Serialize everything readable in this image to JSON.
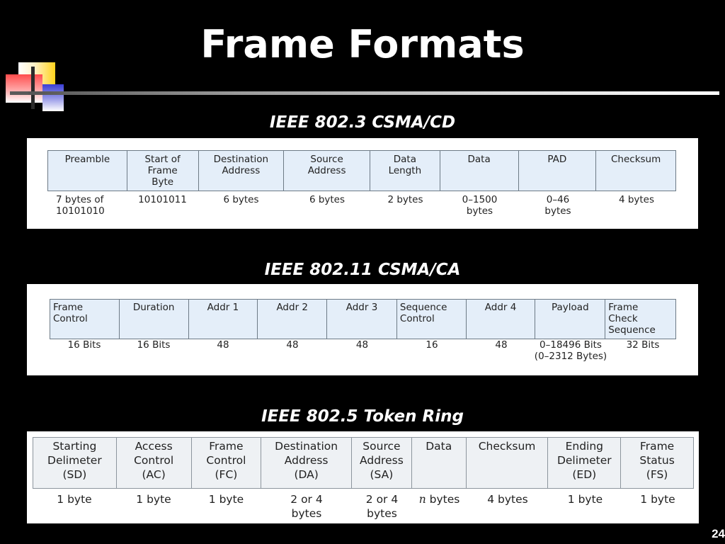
{
  "slide": {
    "title": "Frame Formats",
    "page_number": "24"
  },
  "sections": [
    {
      "heading": "IEEE 802.3 CSMA/CD",
      "fields": [
        {
          "name": "Preamble",
          "size": "7 bytes of\n10101010"
        },
        {
          "name": "Start of\nFrame\nByte",
          "size": "10101011"
        },
        {
          "name": "Destination\nAddress",
          "size": "6 bytes"
        },
        {
          "name": "Source\nAddress",
          "size": "6 bytes"
        },
        {
          "name": "Data\nLength",
          "size": "2 bytes"
        },
        {
          "name": "Data",
          "size": "0–1500\nbytes"
        },
        {
          "name": "PAD",
          "size": "0–46\nbytes"
        },
        {
          "name": "Checksum",
          "size": "4 bytes"
        }
      ]
    },
    {
      "heading": "IEEE 802.11 CSMA/CA",
      "fields": [
        {
          "name": "Frame\nControl",
          "size": "16 Bits"
        },
        {
          "name": "Duration",
          "size": "16 Bits"
        },
        {
          "name": "Addr 1",
          "size": "48"
        },
        {
          "name": "Addr 2",
          "size": "48"
        },
        {
          "name": "Addr 3",
          "size": "48"
        },
        {
          "name": "Sequence\nControl",
          "size": "16"
        },
        {
          "name": "Addr 4",
          "size": "48"
        },
        {
          "name": "Payload",
          "size": "0–18496 Bits\n(0–2312 Bytes)"
        },
        {
          "name": "Frame\nCheck\nSequence",
          "size": "32 Bits"
        }
      ]
    },
    {
      "heading": "IEEE 802.5 Token Ring",
      "fields": [
        {
          "name": "Starting\nDelimeter\n(SD)",
          "size": "1 byte"
        },
        {
          "name": "Access\nControl\n(AC)",
          "size": "1 byte"
        },
        {
          "name": "Frame\nControl\n(FC)",
          "size": "1 byte"
        },
        {
          "name": "Destination\nAddress\n(DA)",
          "size": "2 or 4\nbytes"
        },
        {
          "name": "Source\nAddress\n(SA)",
          "size": "2 or 4\nbytes"
        },
        {
          "name": "Data",
          "size_var": "n",
          "size": " bytes"
        },
        {
          "name": "Checksum",
          "size": "4 bytes"
        },
        {
          "name": "Ending\nDelimeter\n(ED)",
          "size": "1 byte"
        },
        {
          "name": "Frame\nStatus\n(FS)",
          "size": "1 byte"
        }
      ]
    }
  ]
}
